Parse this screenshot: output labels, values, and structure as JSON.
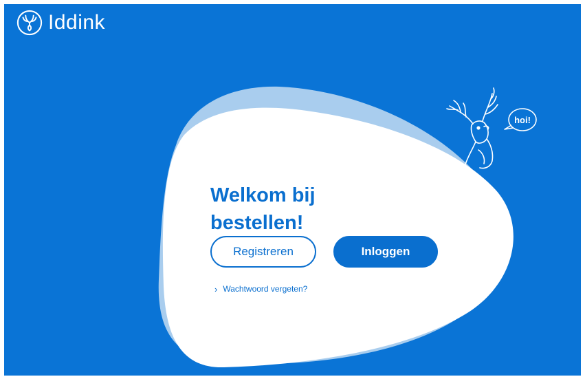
{
  "brand": {
    "name": "Iddink",
    "logo_icon": "deer-head-logo-icon",
    "color": "#0a74d6"
  },
  "mascot": {
    "speech_bubble": "hoi!",
    "icon": "deer-mascot-icon"
  },
  "welcome": {
    "line1": "Welkom bij",
    "line2": "bestellen!"
  },
  "buttons": {
    "register_label": "Registreren",
    "login_label": "Inloggen"
  },
  "forgot_password": {
    "chevron": "›",
    "label": "Wachtwoord vergeten?"
  },
  "colors": {
    "background": "#0a74d6",
    "accent": "#0a6fcf",
    "blob_back": "#a9cdee",
    "blob_front": "#ffffff"
  }
}
